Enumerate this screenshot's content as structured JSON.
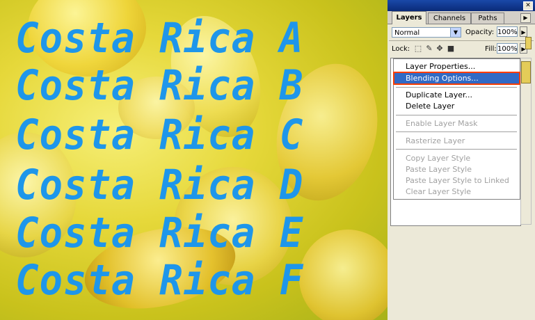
{
  "canvas": {
    "lines": [
      "Costa Rica A",
      "Costa Rica B",
      "Costa Rica C",
      "Costa Rica D",
      "Costa Rica E",
      "Costa Rica F"
    ],
    "text_color": "#1e96ea"
  },
  "layers_panel": {
    "tabs": [
      "Layers",
      "Channels",
      "Paths"
    ],
    "active_tab": "Layers",
    "blend_mode": "Normal",
    "opacity_label": "Opacity:",
    "opacity_value": "100%",
    "lock_label": "Lock:",
    "fill_label": "Fill:",
    "fill_value": "100%",
    "lock_icons": [
      "lock-transparent-icon",
      "lock-brush-icon",
      "lock-move-icon",
      "lock-all-icon"
    ]
  },
  "context_menu": {
    "items": [
      {
        "label": "Layer Properties...",
        "enabled": true
      },
      {
        "label": "Blending Options...",
        "enabled": true,
        "highlighted": true
      },
      {
        "label": "Duplicate Layer...",
        "enabled": true
      },
      {
        "label": "Delete Layer",
        "enabled": true
      },
      {
        "label": "Enable Layer Mask",
        "enabled": false
      },
      {
        "label": "Rasterize Layer",
        "enabled": false
      },
      {
        "label": "Copy Layer Style",
        "enabled": false
      },
      {
        "label": "Paste Layer Style",
        "enabled": false
      },
      {
        "label": "Paste Layer Style to Linked",
        "enabled": false
      },
      {
        "label": "Clear Layer Style",
        "enabled": false
      }
    ],
    "highlight_outline_color": "#ff3c00"
  }
}
